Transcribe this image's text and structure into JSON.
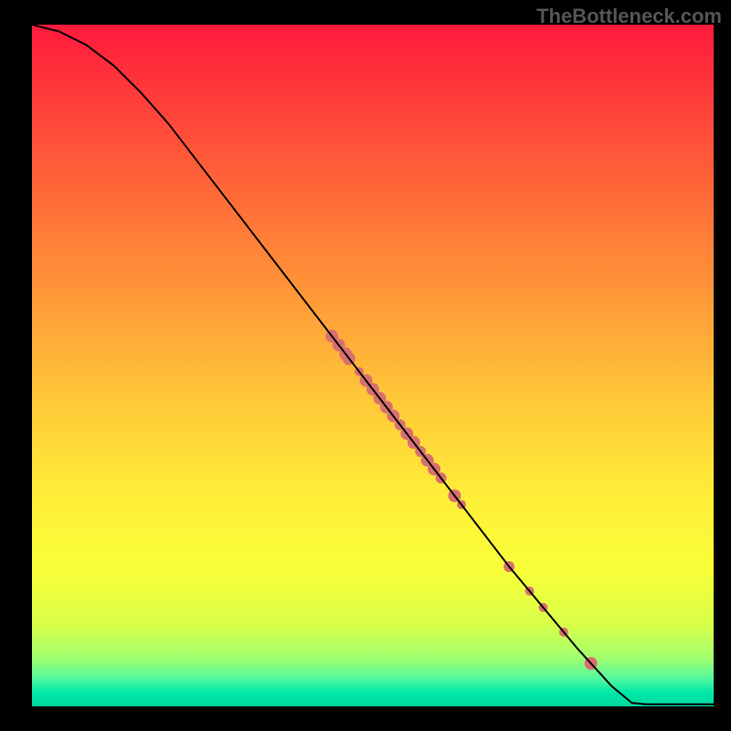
{
  "attribution": "TheBottleneck.com",
  "chart_data": {
    "type": "line",
    "title": "",
    "xlabel": "",
    "ylabel": "",
    "xlim": [
      0,
      100
    ],
    "ylim": [
      0,
      100
    ],
    "curve": [
      {
        "x": 0,
        "y": 100
      },
      {
        "x": 4,
        "y": 99
      },
      {
        "x": 8,
        "y": 97
      },
      {
        "x": 12,
        "y": 94
      },
      {
        "x": 16,
        "y": 90
      },
      {
        "x": 20,
        "y": 85.5
      },
      {
        "x": 25,
        "y": 79
      },
      {
        "x": 30,
        "y": 72.5
      },
      {
        "x": 35,
        "y": 66
      },
      {
        "x": 40,
        "y": 59.5
      },
      {
        "x": 45,
        "y": 53
      },
      {
        "x": 50,
        "y": 46.5
      },
      {
        "x": 55,
        "y": 40
      },
      {
        "x": 60,
        "y": 33.5
      },
      {
        "x": 65,
        "y": 27
      },
      {
        "x": 70,
        "y": 20.5
      },
      {
        "x": 75,
        "y": 14.5
      },
      {
        "x": 80,
        "y": 8.5
      },
      {
        "x": 85,
        "y": 3
      },
      {
        "x": 88,
        "y": 0.5
      },
      {
        "x": 90,
        "y": 0.3
      },
      {
        "x": 100,
        "y": 0.3
      }
    ],
    "markers": [
      {
        "x": 44,
        "y": 54.3,
        "r": 7
      },
      {
        "x": 45,
        "y": 53,
        "r": 7
      },
      {
        "x": 46,
        "y": 51.7,
        "r": 7
      },
      {
        "x": 46.5,
        "y": 51,
        "r": 7
      },
      {
        "x": 48,
        "y": 49.1,
        "r": 5
      },
      {
        "x": 49,
        "y": 47.8,
        "r": 7
      },
      {
        "x": 50,
        "y": 46.5,
        "r": 7
      },
      {
        "x": 51,
        "y": 45.2,
        "r": 7
      },
      {
        "x": 52,
        "y": 43.9,
        "r": 7
      },
      {
        "x": 53,
        "y": 42.6,
        "r": 7
      },
      {
        "x": 54,
        "y": 41.3,
        "r": 6
      },
      {
        "x": 55,
        "y": 40,
        "r": 7
      },
      {
        "x": 56,
        "y": 38.7,
        "r": 7
      },
      {
        "x": 57,
        "y": 37.4,
        "r": 6
      },
      {
        "x": 58,
        "y": 36.1,
        "r": 7
      },
      {
        "x": 59,
        "y": 34.8,
        "r": 7
      },
      {
        "x": 60,
        "y": 33.5,
        "r": 6
      },
      {
        "x": 62,
        "y": 30.9,
        "r": 7
      },
      {
        "x": 63,
        "y": 29.6,
        "r": 5
      },
      {
        "x": 70,
        "y": 20.5,
        "r": 6
      },
      {
        "x": 73,
        "y": 16.9,
        "r": 5
      },
      {
        "x": 75,
        "y": 14.5,
        "r": 5
      },
      {
        "x": 78,
        "y": 10.9,
        "r": 5
      },
      {
        "x": 82,
        "y": 6.3,
        "r": 7
      }
    ],
    "marker_color": "#d97070",
    "curve_color": "#000000"
  }
}
